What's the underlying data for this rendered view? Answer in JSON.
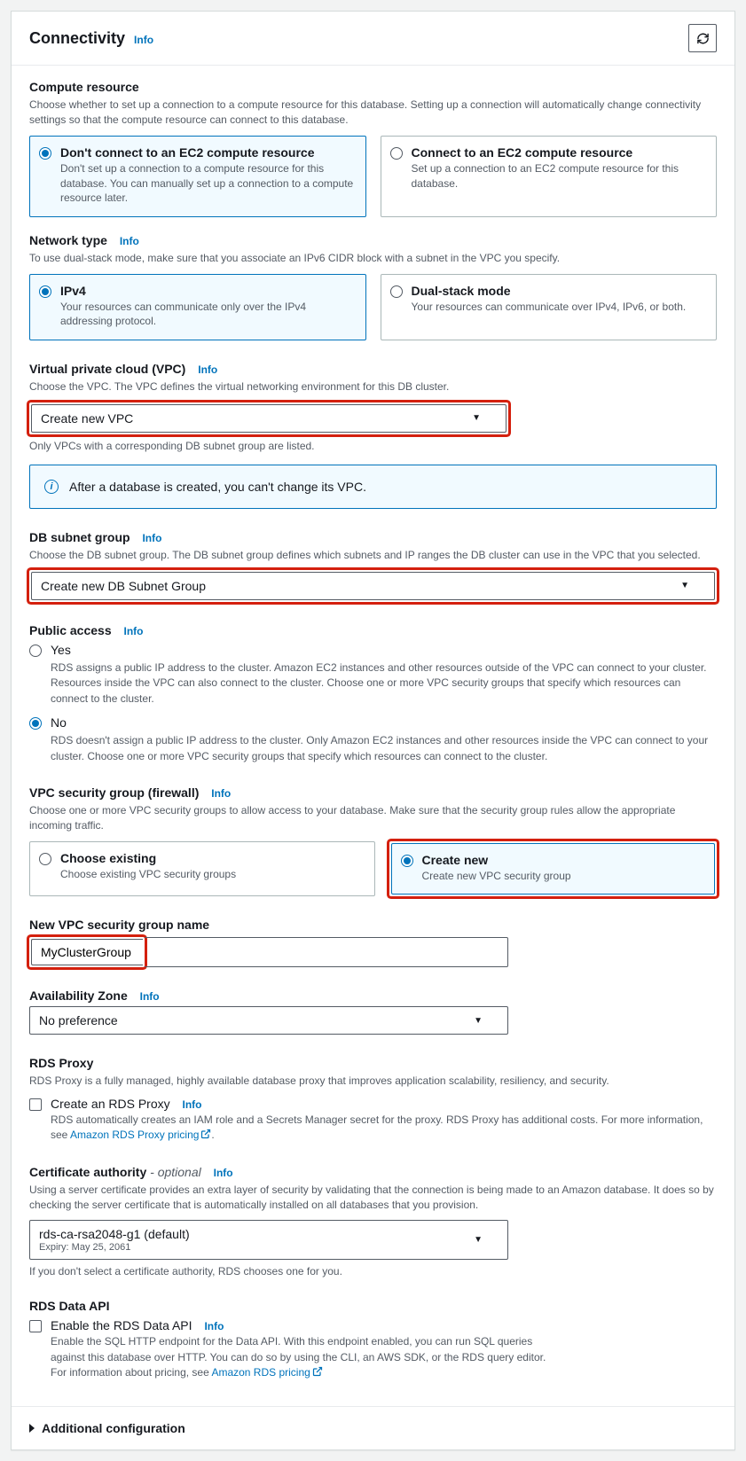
{
  "header": {
    "title": "Connectivity",
    "info": "Info"
  },
  "compute": {
    "title": "Compute resource",
    "desc": "Choose whether to set up a connection to a compute resource for this database. Setting up a connection will automatically change connectivity settings so that the compute resource can connect to this database.",
    "opt1_label": "Don't connect to an EC2 compute resource",
    "opt1_desc": "Don't set up a connection to a compute resource for this database. You can manually set up a connection to a compute resource later.",
    "opt2_label": "Connect to an EC2 compute resource",
    "opt2_desc": "Set up a connection to an EC2 compute resource for this database."
  },
  "network": {
    "title": "Network type",
    "info": "Info",
    "desc": "To use dual-stack mode, make sure that you associate an IPv6 CIDR block with a subnet in the VPC you specify.",
    "opt1_label": "IPv4",
    "opt1_desc": "Your resources can communicate only over the IPv4 addressing protocol.",
    "opt2_label": "Dual-stack mode",
    "opt2_desc": "Your resources can communicate over IPv4, IPv6, or both."
  },
  "vpc": {
    "title": "Virtual private cloud (VPC)",
    "info": "Info",
    "desc": "Choose the VPC. The VPC defines the virtual networking environment for this DB cluster.",
    "value": "Create new VPC",
    "footnote": "Only VPCs with a corresponding DB subnet group are listed.",
    "notice": "After a database is created, you can't change its VPC."
  },
  "subnet": {
    "title": "DB subnet group",
    "info": "Info",
    "desc": "Choose the DB subnet group. The DB subnet group defines which subnets and IP ranges the DB cluster can use in the VPC that you selected.",
    "value": "Create new DB Subnet Group"
  },
  "publicAccess": {
    "title": "Public access",
    "info": "Info",
    "yes_label": "Yes",
    "yes_desc": "RDS assigns a public IP address to the cluster. Amazon EC2 instances and other resources outside of the VPC can connect to your cluster. Resources inside the VPC can also connect to the cluster. Choose one or more VPC security groups that specify which resources can connect to the cluster.",
    "no_label": "No",
    "no_desc": "RDS doesn't assign a public IP address to the cluster. Only Amazon EC2 instances and other resources inside the VPC can connect to your cluster. Choose one or more VPC security groups that specify which resources can connect to the cluster."
  },
  "secgroup": {
    "title": "VPC security group (firewall)",
    "info": "Info",
    "desc": "Choose one or more VPC security groups to allow access to your database. Make sure that the security group rules allow the appropriate incoming traffic.",
    "opt1_label": "Choose existing",
    "opt1_desc": "Choose existing VPC security groups",
    "opt2_label": "Create new",
    "opt2_desc": "Create new VPC security group"
  },
  "newSg": {
    "title": "New VPC security group name",
    "value": "MyClusterGroup"
  },
  "az": {
    "title": "Availability Zone",
    "info": "Info",
    "value": "No preference"
  },
  "proxy": {
    "title": "RDS Proxy",
    "desc": "RDS Proxy is a fully managed, highly available database proxy that improves application scalability, resiliency, and security.",
    "cb_label": "Create an RDS Proxy",
    "info": "Info",
    "cb_desc": "RDS automatically creates an IAM role and a Secrets Manager secret for the proxy. RDS Proxy has additional costs. For more information, see ",
    "link": "Amazon RDS Proxy pricing"
  },
  "cert": {
    "title": "Certificate authority",
    "suffix": " - optional",
    "info": "Info",
    "desc": "Using a server certificate provides an extra layer of security by validating that the connection is being made to an Amazon database. It does so by checking the server certificate that is automatically installed on all databases that you provision.",
    "value": "rds-ca-rsa2048-g1 (default)",
    "expiry": "Expiry: May 25, 2061",
    "footnote": "If you don't select a certificate authority, RDS chooses one for you."
  },
  "dataApi": {
    "title": "RDS Data API",
    "cb_label": "Enable the RDS Data API",
    "info": "Info",
    "cb_desc": "Enable the SQL HTTP endpoint for the Data API. With this endpoint enabled, you can run SQL queries against this database over HTTP. You can do so by using the CLI, an AWS SDK, or the RDS query editor. For information about pricing, see ",
    "link": "Amazon RDS pricing"
  },
  "footer": {
    "label": "Additional configuration"
  }
}
